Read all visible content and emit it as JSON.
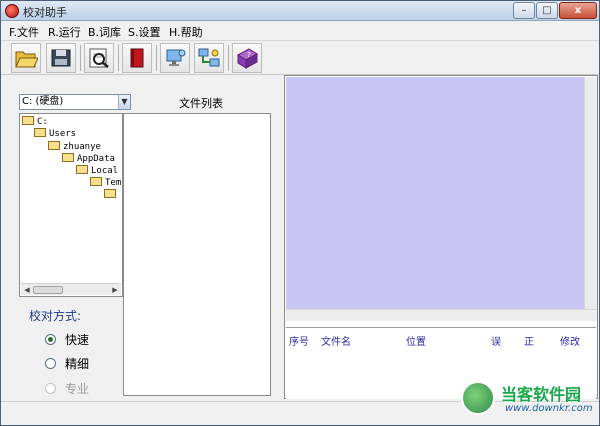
{
  "window": {
    "title": "校对助手",
    "min_symbol": "–",
    "max_symbol": "□",
    "close_symbol": "x"
  },
  "menu": [
    {
      "label": "F.文件"
    },
    {
      "label": "R.运行"
    },
    {
      "label": "B.词库"
    },
    {
      "label": "S.设置"
    },
    {
      "label": "H.帮助"
    }
  ],
  "toolbar": {
    "buttons": [
      {
        "icon": "open-folder-icon"
      },
      {
        "icon": "floppy-disk-icon"
      },
      {
        "icon": "search-document-icon"
      },
      {
        "icon": "red-book-icon"
      },
      {
        "icon": "network-computer-icon"
      },
      {
        "icon": "network-connection-icon"
      },
      {
        "icon": "help-book-icon"
      }
    ]
  },
  "left": {
    "drive": "C: (硬盘)",
    "file_list_title": "文件列表",
    "tree": [
      {
        "label": "C:"
      },
      {
        "label": "Users"
      },
      {
        "label": "zhuanye"
      },
      {
        "label": "AppData"
      },
      {
        "label": "Local"
      },
      {
        "label": "Tem"
      },
      {
        "label": ""
      }
    ],
    "mode_label": "校对方式:",
    "modes": [
      {
        "label": "快速",
        "checked": true,
        "disabled": false
      },
      {
        "label": "精细",
        "checked": false,
        "disabled": false
      },
      {
        "label": "专业",
        "checked": false,
        "disabled": true
      }
    ]
  },
  "right": {
    "columns": [
      "序号",
      "文件名",
      "位置",
      "误",
      "正",
      "修改"
    ]
  },
  "watermark": {
    "brand": "当客软件园",
    "url": "www.downkr.com"
  },
  "colors": {
    "preview_bg": "#c9c6f5",
    "header_text": "#2a2aa6",
    "titlebar": "#bcd0e7"
  }
}
